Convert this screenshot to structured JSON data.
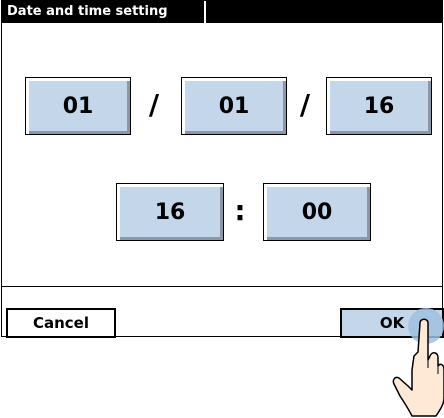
{
  "window": {
    "title": "Date and time setting"
  },
  "date": {
    "month": "01",
    "day": "01",
    "year": "16",
    "separator": "/"
  },
  "time": {
    "hour": "16",
    "minute": "00",
    "separator": ":"
  },
  "buttons": {
    "cancel": "Cancel",
    "ok": "OK"
  },
  "colors": {
    "field_fill": "#c4d7ea",
    "title_bar": "#000000",
    "touch_highlight": "#9fc1df"
  },
  "icons": {
    "pointer": "hand-pointer-icon"
  }
}
